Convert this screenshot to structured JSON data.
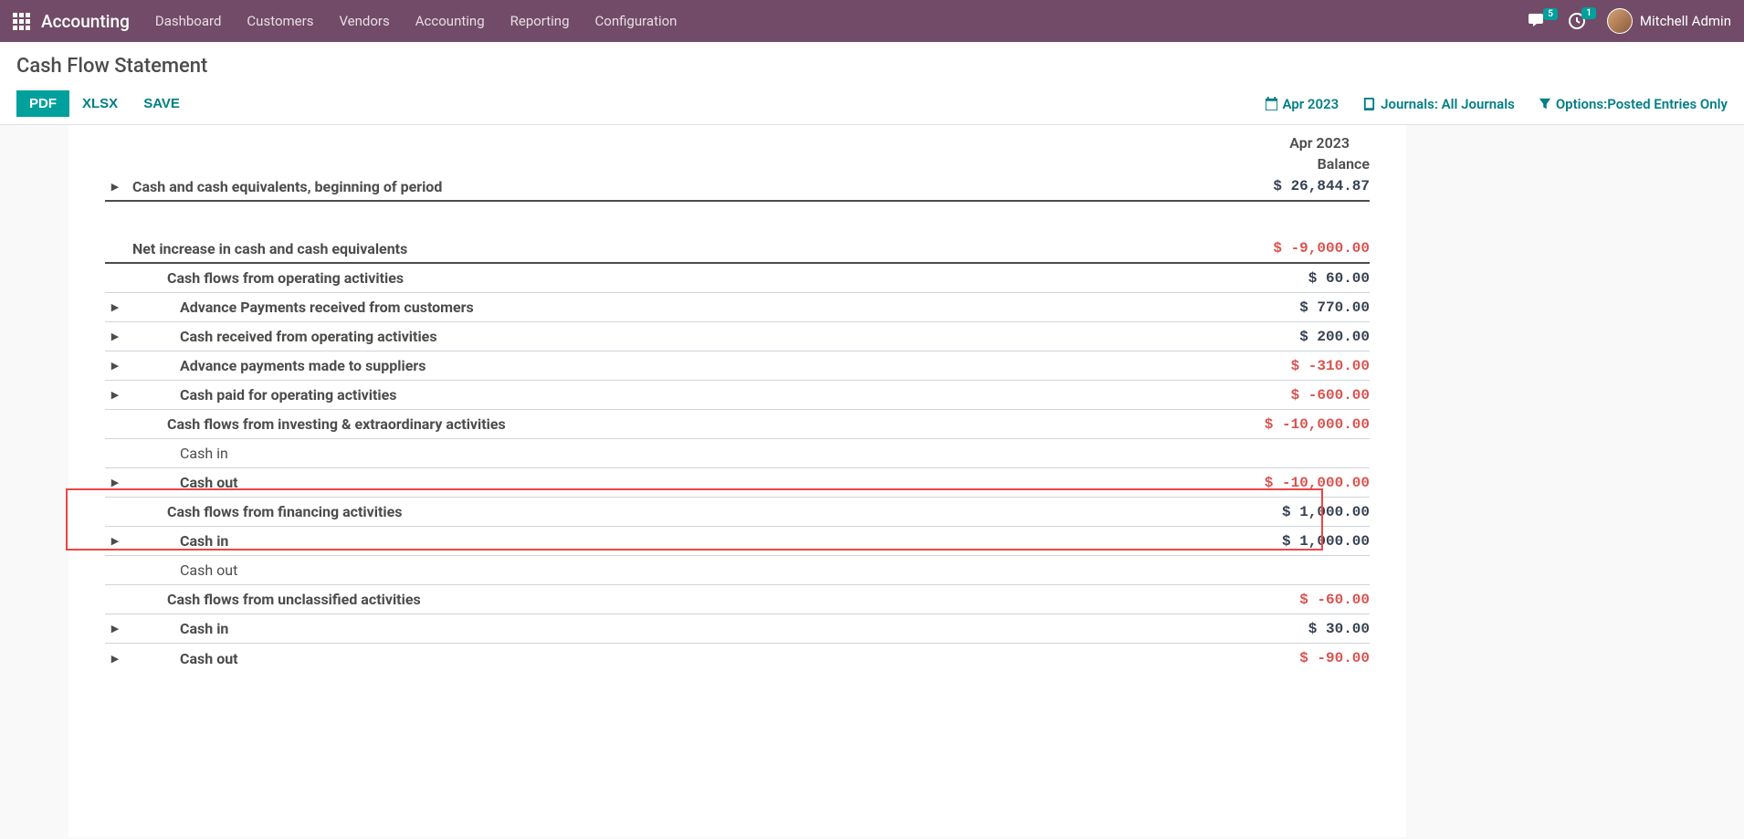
{
  "nav": {
    "brand": "Accounting",
    "items": [
      "Dashboard",
      "Customers",
      "Vendors",
      "Accounting",
      "Reporting",
      "Configuration"
    ],
    "msg_badge": "5",
    "activity_badge": "1",
    "username": "Mitchell Admin"
  },
  "page": {
    "title": "Cash Flow Statement",
    "btn_pdf": "PDF",
    "btn_xlsx": "XLSX",
    "btn_save": "SAVE",
    "filter_date": "Apr 2023",
    "filter_journals_label": "Journals:",
    "filter_journals_value": " All Journals",
    "filter_options_label": "Options:",
    "filter_options_value": "Posted Entries Only"
  },
  "report": {
    "period": "Apr 2023",
    "balance_header": "Balance",
    "rows": [
      {
        "label": "Cash and cash equivalents, beginning of period",
        "value": "$ 26,844.87",
        "bold": true,
        "indent": 0,
        "neg": false,
        "caret": true,
        "thick": true
      },
      {
        "spacer": true
      },
      {
        "label": "Net increase in cash and cash equivalents",
        "value": "$ -9,000.00",
        "bold": true,
        "indent": 0,
        "neg": true,
        "caret": false,
        "thick": true
      },
      {
        "label": "Cash flows from operating activities",
        "value": "$ 60.00",
        "bold": true,
        "indent": 1,
        "neg": false,
        "caret": false
      },
      {
        "label": "Advance Payments received from customers",
        "value": "$ 770.00",
        "bold": true,
        "indent": 2,
        "neg": false,
        "caret": true
      },
      {
        "label": "Cash received from operating activities",
        "value": "$ 200.00",
        "bold": true,
        "indent": 2,
        "neg": false,
        "caret": true
      },
      {
        "label": "Advance payments made to suppliers",
        "value": "$ -310.00",
        "bold": true,
        "indent": 2,
        "neg": true,
        "caret": true
      },
      {
        "label": "Cash paid for operating activities",
        "value": "$ -600.00",
        "bold": true,
        "indent": 2,
        "neg": true,
        "caret": true
      },
      {
        "label": "Cash flows from investing & extraordinary activities",
        "value": "$ -10,000.00",
        "bold": true,
        "indent": 1,
        "neg": true,
        "caret": false
      },
      {
        "label": "Cash in",
        "value": "",
        "bold": false,
        "indent": 2,
        "neg": false,
        "caret": false
      },
      {
        "label": "Cash out",
        "value": "$ -10,000.00",
        "bold": true,
        "indent": 2,
        "neg": true,
        "caret": true
      },
      {
        "label": "Cash flows from financing activities",
        "value": "$ 1,000.00",
        "bold": true,
        "indent": 1,
        "neg": false,
        "caret": false
      },
      {
        "label": "Cash in",
        "value": "$ 1,000.00",
        "bold": true,
        "indent": 2,
        "neg": false,
        "caret": true
      },
      {
        "label": "Cash out",
        "value": "",
        "bold": false,
        "indent": 2,
        "neg": false,
        "caret": false
      },
      {
        "label": "Cash flows from unclassified activities",
        "value": "$ -60.00",
        "bold": true,
        "indent": 1,
        "neg": true,
        "caret": false
      },
      {
        "label": "Cash in",
        "value": "$ 30.00",
        "bold": true,
        "indent": 2,
        "neg": false,
        "caret": true
      },
      {
        "label": "Cash out",
        "value": "$ -90.00",
        "bold": true,
        "indent": 2,
        "neg": true,
        "caret": true,
        "noborder": true
      }
    ]
  }
}
